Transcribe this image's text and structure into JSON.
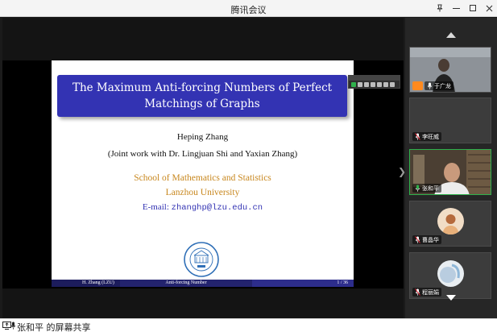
{
  "window": {
    "title": "腾讯会议"
  },
  "slide": {
    "title_line1": "The Maximum Anti-forcing Numbers of Perfect",
    "title_line2": "Matchings of Graphs",
    "author": "Heping Zhang",
    "joint": "(Joint work with Dr. Lingjuan Shi and Yaxian Zhang)",
    "school": "School of Mathematics and Statistics",
    "university": "Lanzhou University",
    "email_prefix": "E-mail: ",
    "email_address": "zhanghp@lzu.edu.cn",
    "footer_left": "H. Zhang (LZU)",
    "footer_center": "Anti-forcing Number",
    "footer_right": "1 / 36"
  },
  "participants": [
    {
      "name": "于广龙",
      "role": "host"
    },
    {
      "name": "李旺威"
    },
    {
      "name": "张和平",
      "speaking": true
    },
    {
      "name": "曹晶华"
    },
    {
      "name": "程丽娟"
    }
  ],
  "status": {
    "sharing_text": "张和平 的屏幕共享"
  },
  "colors": {
    "slide_title_bg": "#3333b3",
    "affiliation": "#c8871e",
    "speaking_border": "#2fb24c",
    "host_badge": "#ff8a1f"
  }
}
